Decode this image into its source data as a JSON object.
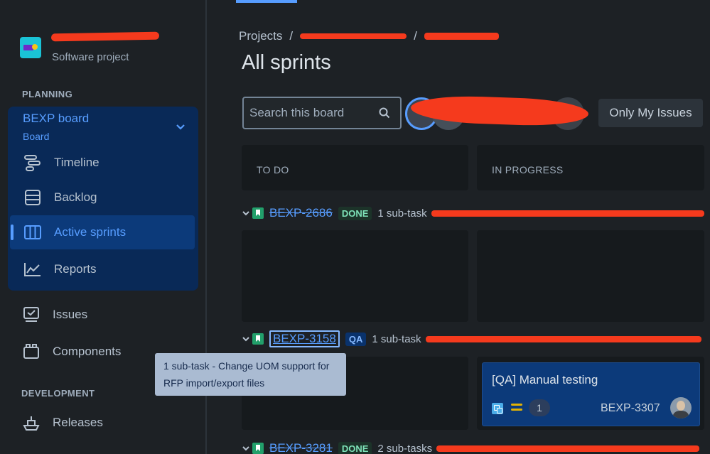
{
  "sidebar": {
    "project_type": "Software project",
    "planning_heading": "PLANNING",
    "board_title": "BEXP board",
    "board_subtitle": "Board",
    "planning_items": [
      {
        "label": "Timeline",
        "icon": "timeline-icon"
      },
      {
        "label": "Backlog",
        "icon": "backlog-icon"
      },
      {
        "label": "Active sprints",
        "icon": "active-sprints-icon",
        "active": true
      },
      {
        "label": "Reports",
        "icon": "reports-icon"
      }
    ],
    "other_items": [
      {
        "label": "Issues",
        "icon": "issues-icon"
      },
      {
        "label": "Components",
        "icon": "components-icon"
      }
    ],
    "development_heading": "DEVELOPMENT",
    "development_items": [
      {
        "label": "Releases",
        "icon": "releases-icon"
      }
    ]
  },
  "breadcrumb": {
    "root": "Projects",
    "separator": "/"
  },
  "page_title": "All sprints",
  "search": {
    "placeholder": "Search this board"
  },
  "only_my_issues": "Only My Issues",
  "columns": [
    "TO DO",
    "IN PROGRESS"
  ],
  "swimlanes": [
    {
      "key": "BEXP-2686",
      "status": "DONE",
      "subtasks": "1 sub-task"
    },
    {
      "key": "BEXP-3158",
      "status": "QA",
      "subtasks": "1 sub-task"
    },
    {
      "key": "BEXP-3281",
      "status": "DONE",
      "subtasks": "2 sub-tasks"
    }
  ],
  "card": {
    "title": "[QA] Manual testing",
    "estimate": "1",
    "key": "BEXP-3307"
  },
  "tooltip": {
    "text": "1 sub-task - Change UOM support for RFP import/export files"
  },
  "colors": {
    "accent": "#579dff",
    "done": "#22a06b",
    "redaction": "#f53a1d"
  }
}
